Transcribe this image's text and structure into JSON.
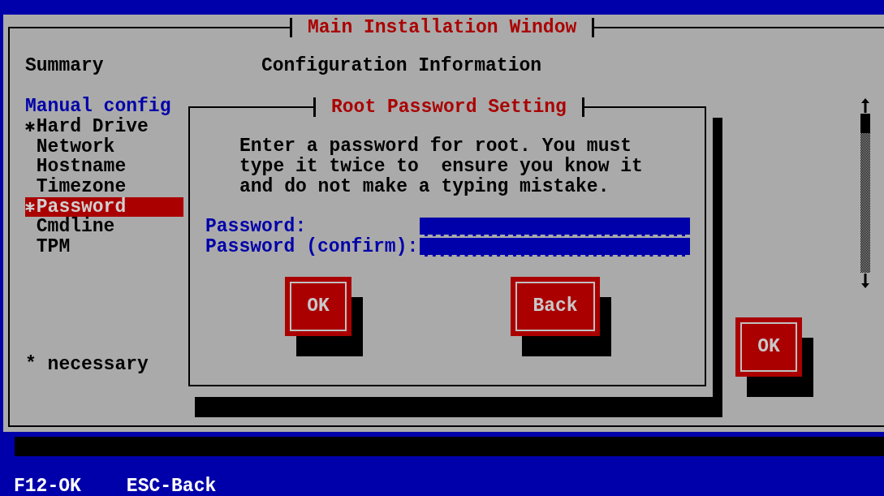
{
  "window": {
    "title": "Main Installation Window"
  },
  "summary": {
    "title": "Summary",
    "heading": "Manual config",
    "items": [
      {
        "label": "Hard Drive",
        "required": true,
        "selected": false
      },
      {
        "label": "Network",
        "required": false,
        "selected": false
      },
      {
        "label": "Hostname",
        "required": false,
        "selected": false
      },
      {
        "label": "Timezone",
        "required": false,
        "selected": false
      },
      {
        "label": "Password",
        "required": true,
        "selected": true
      },
      {
        "label": "Cmdline",
        "required": false,
        "selected": false
      },
      {
        "label": "TPM",
        "required": false,
        "selected": false
      }
    ],
    "footnote": "* necessary"
  },
  "info": {
    "title": "Configuration Information"
  },
  "ok_button": "OK",
  "dialog": {
    "title": "Root Password Setting",
    "message": "Enter a password for root. You must\ntype it twice to  ensure you know it\nand do not make a typing mistake.",
    "fields": [
      {
        "label": "Password:"
      },
      {
        "label": "Password (confirm):"
      }
    ],
    "buttons": [
      "OK",
      "Back"
    ]
  },
  "status_bar": [
    "F12-OK",
    "ESC-Back"
  ]
}
